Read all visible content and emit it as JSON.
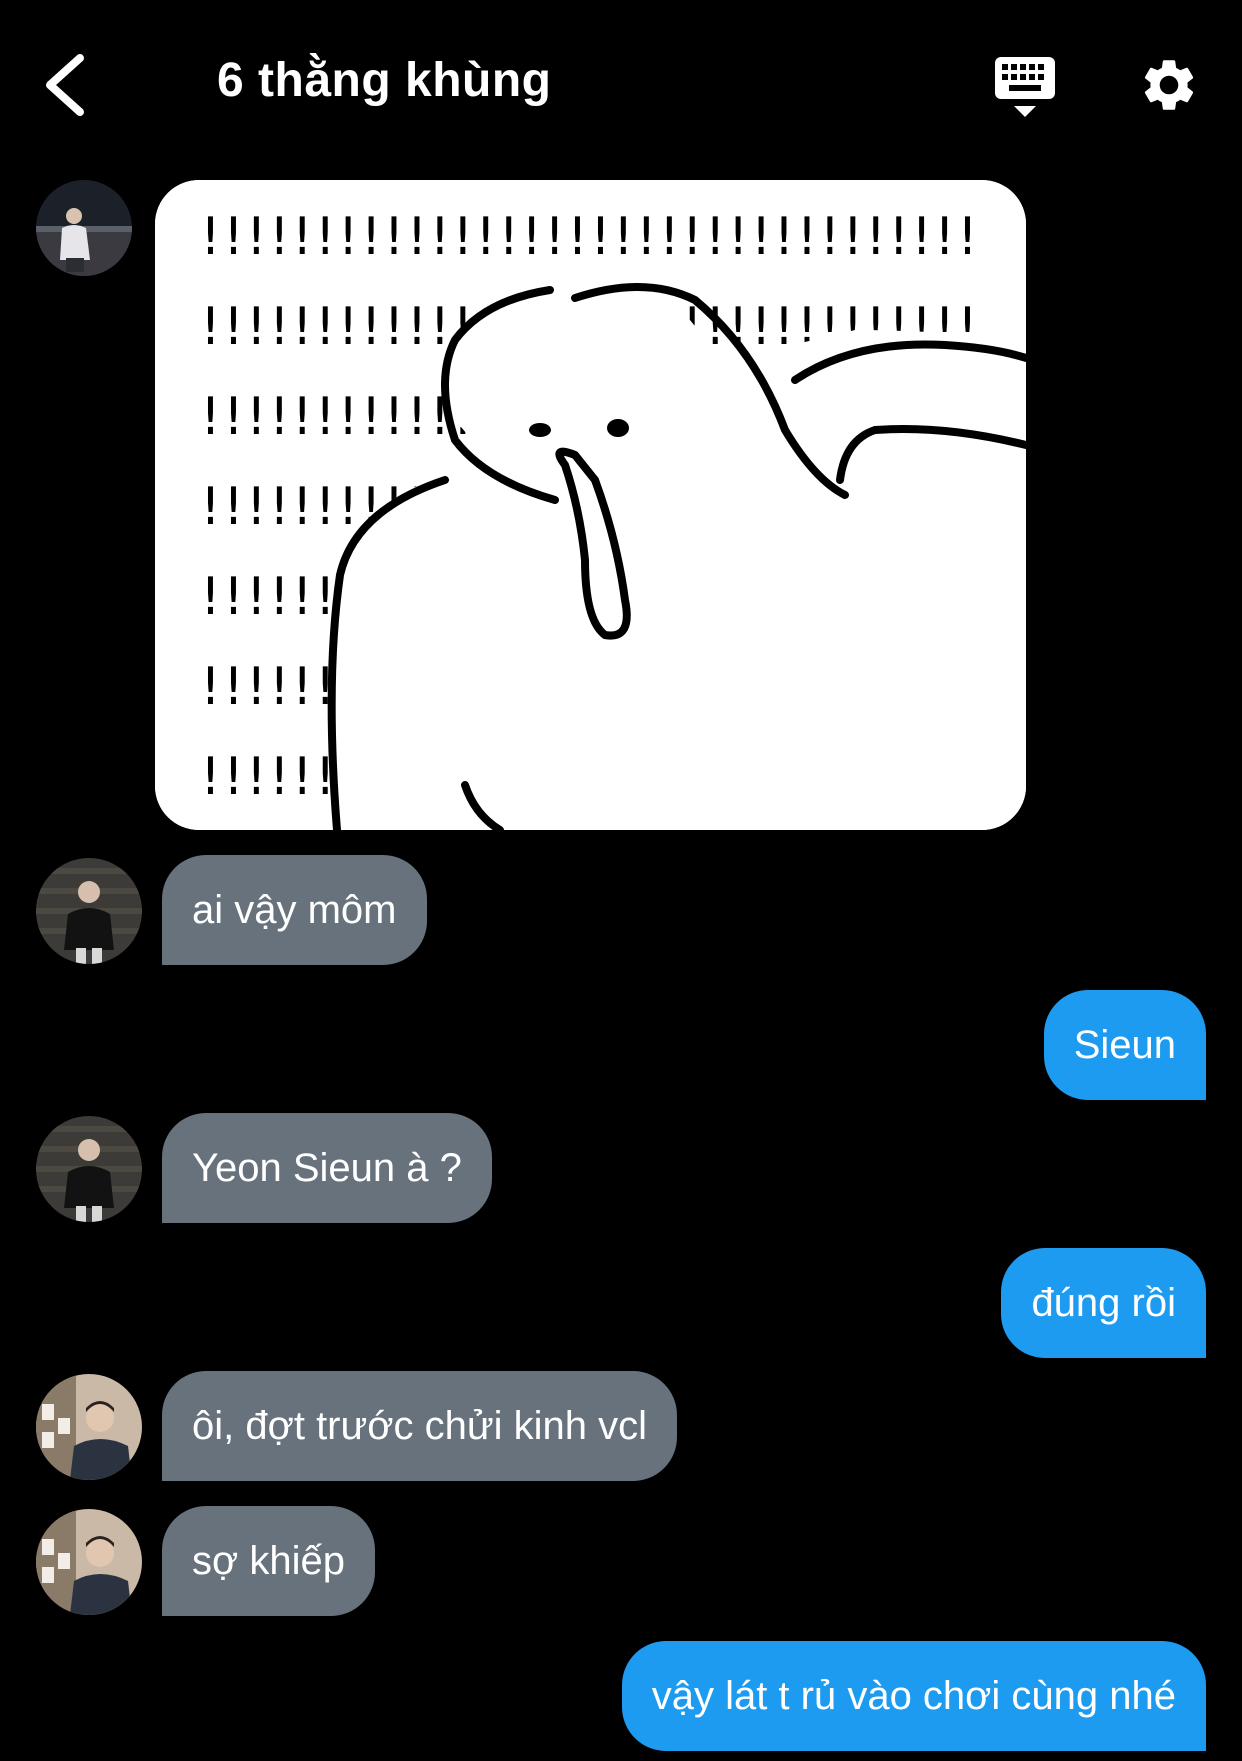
{
  "header": {
    "title": "6 thằng khùng",
    "back_icon": "chevron-left-icon",
    "keyboard_icon": "keyboard-hide-icon",
    "settings_icon": "gear-icon"
  },
  "colors": {
    "background": "#000000",
    "incoming_bubble": "#67727d",
    "outgoing_bubble": "#1d9bf0",
    "text": "#ffffff"
  },
  "messages": [
    {
      "direction": "incoming",
      "type": "sticker",
      "sticker": "shocked-creature-exclamation-sticker"
    },
    {
      "direction": "incoming",
      "type": "text",
      "text": "ai vậy môm"
    },
    {
      "direction": "outgoing",
      "type": "text",
      "text": "Sieun"
    },
    {
      "direction": "incoming",
      "type": "text",
      "text": "Yeon Sieun à ?"
    },
    {
      "direction": "outgoing",
      "type": "text",
      "text": "đúng rồi"
    },
    {
      "direction": "incoming",
      "type": "text",
      "text": "ôi, đợt trước chửi kinh vcl"
    },
    {
      "direction": "incoming",
      "type": "text",
      "text": "sợ khiếp"
    },
    {
      "direction": "outgoing",
      "type": "text",
      "text": "vậy lát t rủ vào chơi cùng nhé"
    }
  ]
}
